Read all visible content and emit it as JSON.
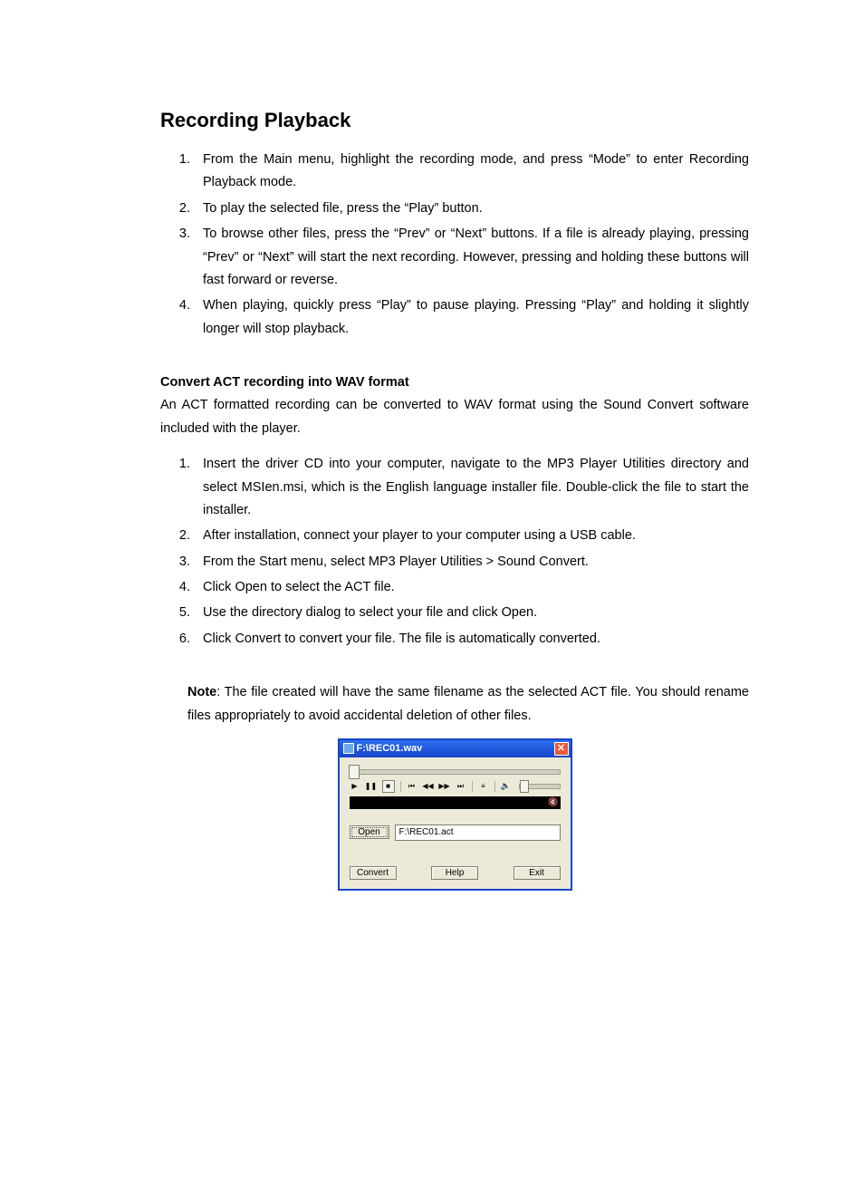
{
  "heading": "Recording Playback",
  "steps_playback": [
    "From the Main menu, highlight the recording mode, and press “Mode” to enter Recording Playback mode.",
    "To play the selected file, press the “Play” button.",
    "To browse other files, press the “Prev” or “Next” buttons. If a file is already playing, pressing “Prev” or “Next” will start the next recording. However, pressing and holding these buttons will fast forward or reverse.",
    "When playing, quickly press “Play” to pause playing. Pressing “Play” and holding it slightly longer will stop playback."
  ],
  "subheading": "Convert ACT recording into WAV format",
  "intro_para": "An ACT formatted recording can be converted to WAV format using the Sound Convert software included with the player.",
  "steps_convert": [
    "Insert the driver CD into your computer, navigate to the MP3 Player Utilities directory and select MSIen.msi, which is the English language installer file. Double-click the file to start the installer.",
    "After installation, connect your player to your computer using a USB cable.",
    "From the Start menu, select MP3 Player Utilities > Sound Convert.",
    "Click Open to select the ACT file.",
    "Use the directory dialog to select your file and click Open.",
    "Click Convert to convert your file. The file is automatically converted."
  ],
  "note_label": "Note",
  "note_body": ": The file created will have the same filename as the selected ACT file. You should rename files appropriately to avoid accidental deletion of other files.",
  "app_window": {
    "title": "F:\\REC01.wav",
    "open_button": "Open",
    "file_field": "F:\\REC01.act",
    "convert_button": "Convert",
    "help_button": "Help",
    "exit_button": "Exit"
  }
}
